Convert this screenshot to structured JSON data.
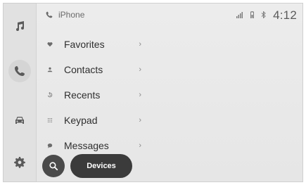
{
  "status_bar": {
    "device_name": "iPhone",
    "time": "4:12",
    "icons": [
      "signal-icon",
      "battery-icon",
      "bluetooth-icon"
    ]
  },
  "rail": {
    "items": [
      {
        "name": "music",
        "icon": "music-note-icon"
      },
      {
        "name": "phone",
        "icon": "phone-icon",
        "active": true
      },
      {
        "name": "car",
        "icon": "car-icon"
      },
      {
        "name": "settings",
        "icon": "gear-icon"
      }
    ]
  },
  "menu": {
    "items": [
      {
        "label": "Favorites",
        "icon": "heart-icon"
      },
      {
        "label": "Contacts",
        "icon": "person-icon"
      },
      {
        "label": "Recents",
        "icon": "history-icon"
      },
      {
        "label": "Keypad",
        "icon": "keypad-icon"
      },
      {
        "label": "Messages",
        "icon": "message-icon"
      }
    ],
    "chevron": "›"
  },
  "bottom": {
    "devices_label": "Devices",
    "search_icon": "search-icon"
  },
  "colors": {
    "background": "#e6e6e6",
    "rail": "#e1e1e1",
    "button_dark": "#3b3b3b",
    "text": "#2f2f2f"
  }
}
